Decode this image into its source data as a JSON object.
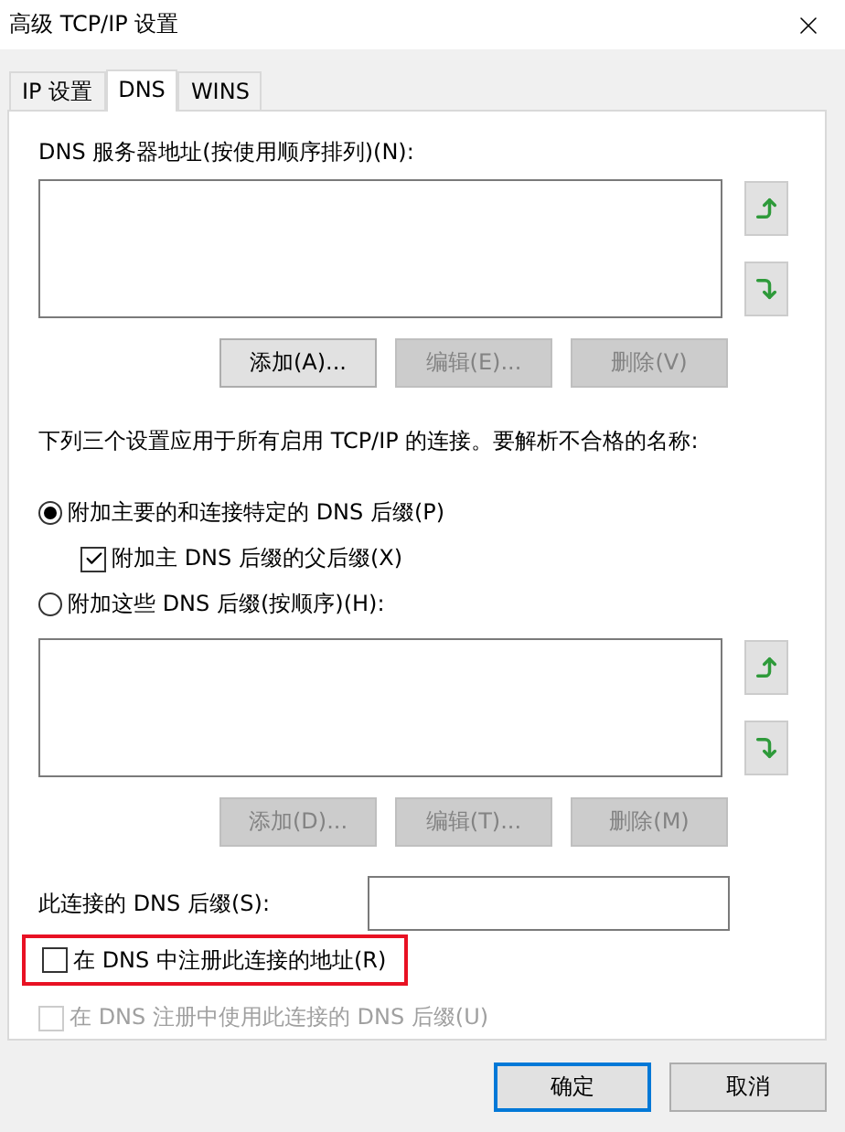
{
  "window": {
    "title": "高级 TCP/IP 设置"
  },
  "tabs": [
    {
      "label": "IP 设置",
      "selected": false
    },
    {
      "label": "DNS",
      "selected": true
    },
    {
      "label": "WINS",
      "selected": false
    }
  ],
  "dns_servers": {
    "label": "DNS 服务器地址(按使用顺序排列)(N):",
    "buttons": [
      {
        "label": "添加(A)...",
        "disabled": false
      },
      {
        "label": "编辑(E)...",
        "disabled": true
      },
      {
        "label": "删除(V)",
        "disabled": true
      }
    ]
  },
  "note": "下列三个设置应用于所有启用 TCP/IP 的连接。要解析不合格的名称:",
  "suffix_options": [
    {
      "label": "附加主要的和连接特定的 DNS 后缀(P)",
      "selected": true,
      "children": [
        {
          "label": "附加主 DNS 后缀的父后缀(X)",
          "checked": true
        }
      ]
    },
    {
      "label": "附加这些 DNS 后缀(按顺序)(H):",
      "selected": false
    }
  ],
  "suffix_list": {
    "buttons": [
      {
        "label": "添加(D)...",
        "disabled": true
      },
      {
        "label": "编辑(T)...",
        "disabled": true
      },
      {
        "label": "删除(M)",
        "disabled": true
      }
    ]
  },
  "connection_suffix": {
    "label": "此连接的 DNS 后缀(S):"
  },
  "register_options": [
    {
      "label": "在 DNS 中注册此连接的地址(R)",
      "checked": false,
      "disabled": false,
      "highlighted": true
    },
    {
      "label": "在 DNS 注册中使用此连接的 DNS 后缀(U)",
      "checked": false,
      "disabled": true,
      "highlighted": false
    }
  ],
  "buttons": [
    {
      "label": "确定",
      "default": true
    },
    {
      "label": "取消",
      "default": false
    }
  ]
}
